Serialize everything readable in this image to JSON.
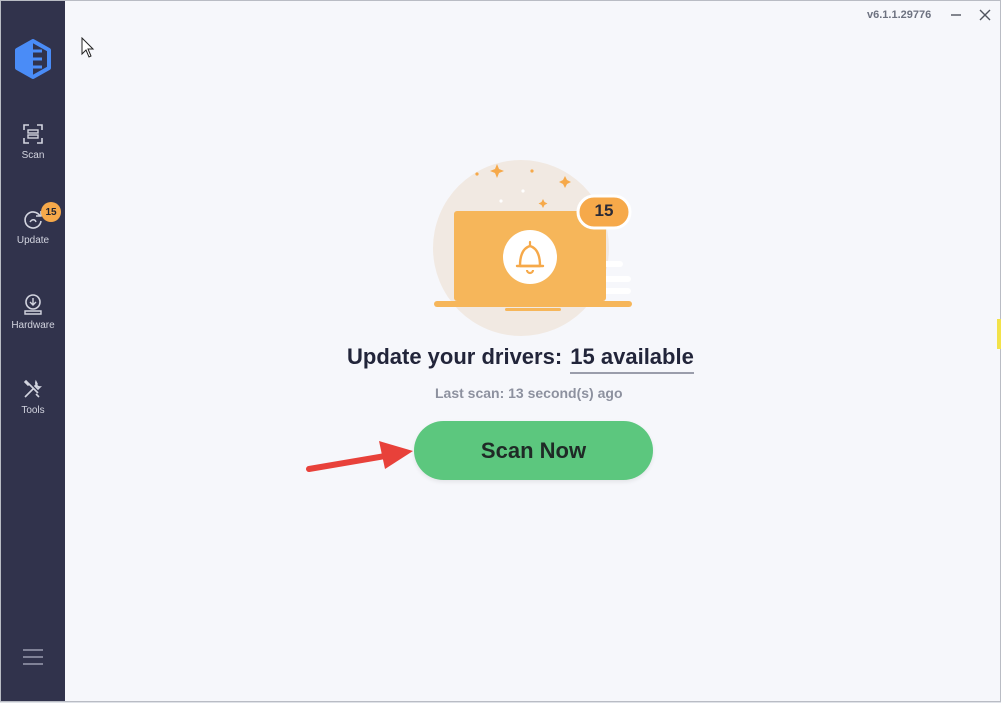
{
  "app": {
    "version": "v6.1.1.29776"
  },
  "sidebar": {
    "items": [
      {
        "label": "Scan",
        "icon": "scan-icon"
      },
      {
        "label": "Update",
        "icon": "update-icon",
        "badge": "15"
      },
      {
        "label": "Hardware",
        "icon": "hardware-icon"
      },
      {
        "label": "Tools",
        "icon": "tools-icon"
      }
    ],
    "menu_icon": "hamburger-menu-icon"
  },
  "main": {
    "badge_count": "15",
    "headline_prefix": "Update your drivers:",
    "headline_available": "15 available",
    "last_scan": "Last scan: 13 second(s) ago",
    "scan_button": "Scan Now"
  },
  "colors": {
    "sidebar_bg": "#31334c",
    "accent_orange": "#f6a94a",
    "scan_green": "#5cc77e",
    "arrow_red": "#e8413a"
  }
}
